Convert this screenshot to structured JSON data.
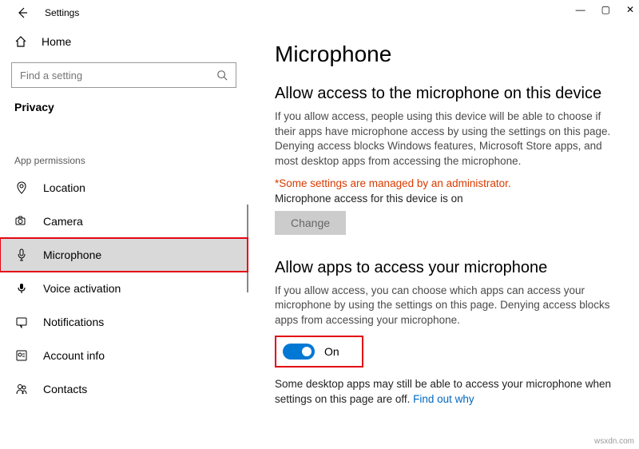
{
  "window": {
    "title": "Settings",
    "watermark": "wsxdn.com"
  },
  "sidebar": {
    "home_label": "Home",
    "search_placeholder": "Find a setting",
    "header": "Privacy",
    "section": "App permissions",
    "items": [
      {
        "label": "Location"
      },
      {
        "label": "Camera"
      },
      {
        "label": "Microphone"
      },
      {
        "label": "Voice activation"
      },
      {
        "label": "Notifications"
      },
      {
        "label": "Account info"
      },
      {
        "label": "Contacts"
      }
    ]
  },
  "content": {
    "page_title": "Microphone",
    "sec1_title": "Allow access to the microphone on this device",
    "sec1_body": "If you allow access, people using this device will be able to choose if their apps have microphone access by using the settings on this page. Denying access blocks Windows features, Microsoft Store apps, and most desktop apps from accessing the microphone.",
    "admin_note": "*Some settings are managed by an administrator.",
    "status_line": "Microphone access for this device is on",
    "change_label": "Change",
    "sec2_title": "Allow apps to access your microphone",
    "sec2_body": "If you allow access, you can choose which apps can access your microphone by using the settings on this page. Denying access blocks apps from accessing your microphone.",
    "toggle_label": "On",
    "footer_text": "Some desktop apps may still be able to access your microphone when settings on this page are off. ",
    "footer_link": "Find out why"
  }
}
